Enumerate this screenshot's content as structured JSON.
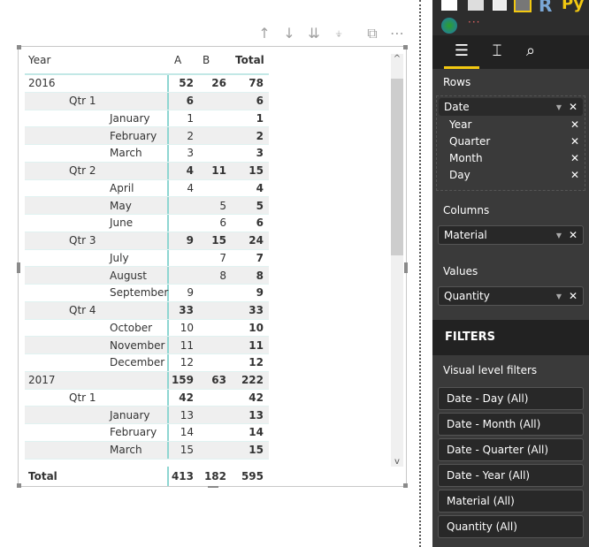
{
  "toolbar": {
    "icons": [
      "sort-ascending",
      "sort-descending",
      "drill-down-all",
      "expand-hierarchy",
      "focus-mode",
      "more-options"
    ]
  },
  "matrix": {
    "headers": [
      "Year",
      "A",
      "B",
      "Total"
    ],
    "rows": [
      {
        "label": "2016",
        "level": 0,
        "a": "52",
        "b": "26",
        "total": "78"
      },
      {
        "label": "Qtr 1",
        "level": 1,
        "a": "6",
        "b": "",
        "total": "6"
      },
      {
        "label": "January",
        "level": 2,
        "a": "1",
        "b": "",
        "total": "1"
      },
      {
        "label": "February",
        "level": 2,
        "a": "2",
        "b": "",
        "total": "2"
      },
      {
        "label": "March",
        "level": 2,
        "a": "3",
        "b": "",
        "total": "3"
      },
      {
        "label": "Qtr 2",
        "level": 1,
        "a": "4",
        "b": "11",
        "total": "15"
      },
      {
        "label": "April",
        "level": 2,
        "a": "4",
        "b": "",
        "total": "4"
      },
      {
        "label": "May",
        "level": 2,
        "a": "",
        "b": "5",
        "total": "5"
      },
      {
        "label": "June",
        "level": 2,
        "a": "",
        "b": "6",
        "total": "6"
      },
      {
        "label": "Qtr 3",
        "level": 1,
        "a": "9",
        "b": "15",
        "total": "24"
      },
      {
        "label": "July",
        "level": 2,
        "a": "",
        "b": "7",
        "total": "7"
      },
      {
        "label": "August",
        "level": 2,
        "a": "",
        "b": "8",
        "total": "8"
      },
      {
        "label": "September",
        "level": 2,
        "a": "9",
        "b": "",
        "total": "9"
      },
      {
        "label": "Qtr 4",
        "level": 1,
        "a": "33",
        "b": "",
        "total": "33"
      },
      {
        "label": "October",
        "level": 2,
        "a": "10",
        "b": "",
        "total": "10"
      },
      {
        "label": "November",
        "level": 2,
        "a": "11",
        "b": "",
        "total": "11"
      },
      {
        "label": "December",
        "level": 2,
        "a": "12",
        "b": "",
        "total": "12"
      },
      {
        "label": "2017",
        "level": 0,
        "a": "159",
        "b": "63",
        "total": "222"
      },
      {
        "label": "Qtr 1",
        "level": 1,
        "a": "42",
        "b": "",
        "total": "42"
      },
      {
        "label": "January",
        "level": 2,
        "a": "13",
        "b": "",
        "total": "13"
      },
      {
        "label": "February",
        "level": 2,
        "a": "14",
        "b": "",
        "total": "14"
      },
      {
        "label": "March",
        "level": 2,
        "a": "15",
        "b": "",
        "total": "15"
      }
    ],
    "total": {
      "label": "Total",
      "a": "413",
      "b": "182",
      "total": "595"
    }
  },
  "panel": {
    "rows_label": "Rows",
    "rows_field": "Date",
    "rows_sub": [
      "Year",
      "Quarter",
      "Month",
      "Day"
    ],
    "columns_label": "Columns",
    "columns_field": "Material",
    "values_label": "Values",
    "values_field": "Quantity",
    "filters_title": "FILTERS",
    "visual_filters_label": "Visual level filters",
    "filters": [
      "Date - Day (All)",
      "Date - Month (All)",
      "Date - Quarter (All)",
      "Date - Year (All)",
      "Material (All)",
      "Quantity (All)"
    ]
  },
  "colors": {
    "accent": "#f2c811",
    "grid_line": "#8fd6d2"
  }
}
